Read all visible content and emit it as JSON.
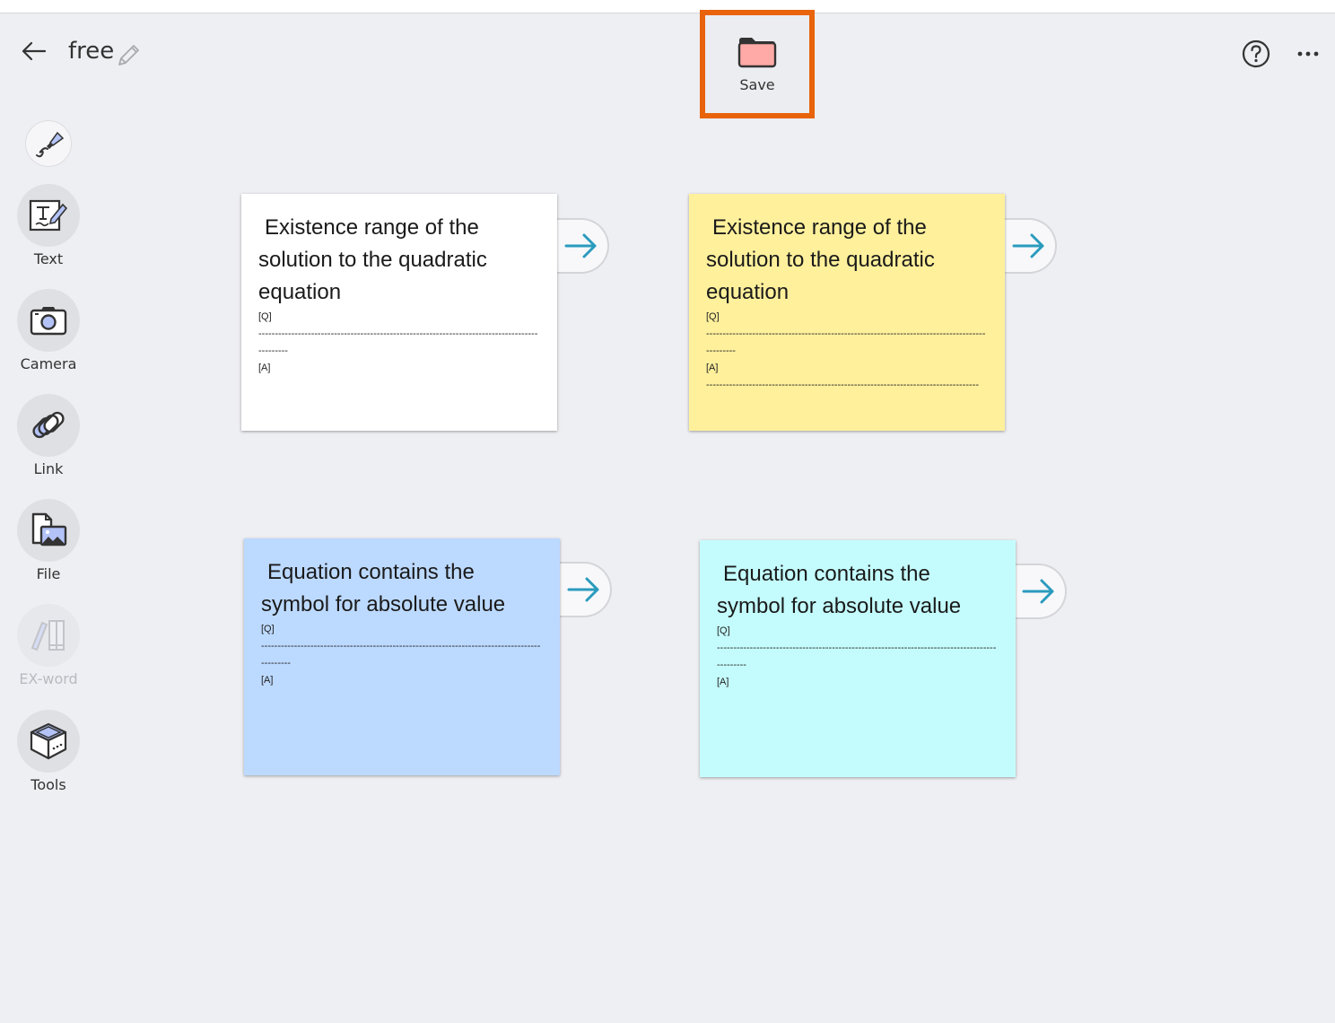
{
  "header": {
    "title": "free",
    "back_icon": "arrow-left-icon",
    "edit_icon": "pencil-icon",
    "save_label": "Save",
    "save_icon": "folder-icon",
    "help_icon": "question-circle-icon",
    "more_icon": "ellipsis-icon",
    "highlight_color": "#e8630a"
  },
  "sidebar": {
    "pen": {
      "icon": "marker-pen-icon"
    },
    "items": [
      {
        "label": "Text",
        "icon": "text-edit-icon",
        "enabled": true
      },
      {
        "label": "Camera",
        "icon": "camera-icon",
        "enabled": true
      },
      {
        "label": "Link",
        "icon": "link-icon",
        "enabled": true
      },
      {
        "label": "File",
        "icon": "file-image-icon",
        "enabled": true
      },
      {
        "label": "EX-word",
        "icon": "books-icon",
        "enabled": false
      },
      {
        "label": "Tools",
        "icon": "toolbox-icon",
        "enabled": true
      }
    ]
  },
  "cards": [
    {
      "title": "Existence range of the solution to the quadratic equation",
      "q_label": "[Q]",
      "q_line": "----------------------------------------------------------------------------------------------",
      "a_label": "[A]",
      "a_line": "",
      "color": "#ffffff",
      "next_icon": "arrow-right-icon"
    },
    {
      "title": "Existence range of the solution to the quadratic equation",
      "q_label": "[Q]",
      "q_line": "----------------------------------------------------------------------------------------------",
      "a_label": "[A]",
      "a_line": "-----------------------------------------------------------------------------------",
      "color": "#fff09c",
      "next_icon": "arrow-right-icon"
    },
    {
      "title": "Equation contains the symbol for absolute value",
      "q_label": "[Q]",
      "q_line": "----------------------------------------------------------------------------------------------",
      "a_label": "[A]",
      "a_line": "",
      "color": "#bcd9ff",
      "next_icon": "arrow-right-icon"
    },
    {
      "title": "Equation contains the symbol for absolute value",
      "q_label": "[Q]",
      "q_line": "----------------------------------------------------------------------------------------------",
      "a_label": "[A]",
      "a_line": "",
      "color": "#c4fcfd",
      "next_icon": "arrow-right-icon"
    }
  ]
}
